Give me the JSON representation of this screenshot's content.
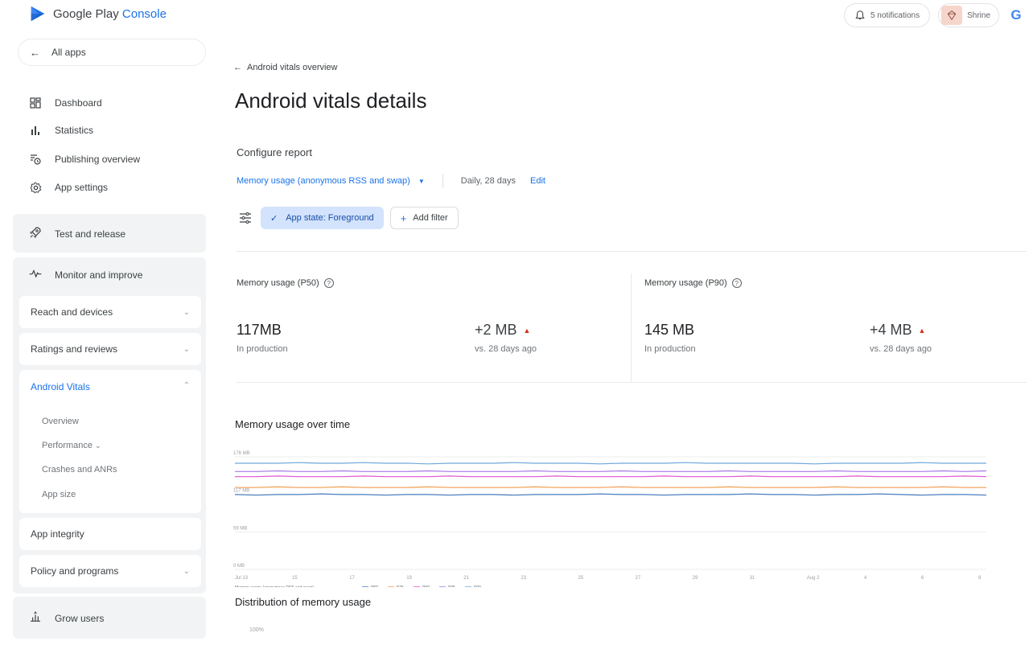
{
  "topbar": {
    "brand_prefix": "Google Play",
    "brand_suffix": "Console",
    "notifications_label": "5 notifications",
    "profile_label": "Shrine",
    "g_letter": "G"
  },
  "sidebar": {
    "all_apps": "All apps",
    "nav": [
      {
        "label": "Dashboard",
        "icon": "dashboard-icon"
      },
      {
        "label": "Statistics",
        "icon": "bar-chart-icon"
      },
      {
        "label": "Publishing overview",
        "icon": "publish-clock-icon"
      },
      {
        "label": "App settings",
        "icon": "gear-icon"
      }
    ],
    "test_release": "Test and release",
    "monitor_improve": "Monitor and improve",
    "reach_devices": "Reach and devices",
    "ratings_reviews": "Ratings and reviews",
    "android_vitals": "Android Vitals",
    "vitals_sub": [
      "Overview",
      "Performance",
      "Crashes and ANRs",
      "App size"
    ],
    "app_integrity": "App integrity",
    "policy_programs": "Policy and programs",
    "grow_users": "Grow users"
  },
  "main": {
    "back_link": "Android vitals overview",
    "title": "Android vitals details",
    "configure_label": "Configure report",
    "metric_selected": "Memory usage (anonymous RSS and swap)",
    "range": "Daily, 28 days",
    "edit": "Edit",
    "filter_active": "App state: Foreground",
    "add_filter": "Add filter",
    "cards": [
      {
        "title": "Memory usage (P50)",
        "value": "117MB",
        "sub": "In production",
        "delta": "+2 MB",
        "delta_sub": "vs. 28 days ago"
      },
      {
        "title": "Memory usage (P90)",
        "value": "145 MB",
        "sub": "In production",
        "delta": "+4 MB",
        "delta_sub": "vs. 28 days ago"
      }
    ],
    "chart_title": "Memory usage over time",
    "dist_title": "Distribution of memory usage",
    "dist_axis_top": "100%"
  },
  "colors": {
    "accent": "#1a73e8",
    "p50": "#4a7fc1",
    "p75": "#f29d52",
    "p90": "#e353d2",
    "p95": "#a678e8",
    "p99": "#6fa8dc"
  },
  "chart_data": {
    "type": "line",
    "title": "Memory usage over time",
    "y_ticks": [
      "176 MB",
      "117 MB",
      "59 MB",
      "0 MB"
    ],
    "ylim": [
      0,
      176
    ],
    "x_ticks": [
      "Jul 13",
      "15",
      "17",
      "19",
      "21",
      "23",
      "25",
      "27",
      "29",
      "31",
      "Aug 2",
      "4",
      "6",
      "8"
    ],
    "legend_label": "Memory usage (anonymous RSS and swap)",
    "series": [
      {
        "name": "P50",
        "values": [
          117,
          116,
          117,
          117,
          118,
          117,
          117,
          116,
          117,
          117,
          116,
          117,
          117,
          116,
          117,
          117,
          117,
          118,
          117,
          117,
          116,
          117,
          117,
          117,
          118,
          117,
          117,
          116,
          117,
          117,
          118,
          117,
          116,
          117,
          117,
          116
        ]
      },
      {
        "name": "P75",
        "values": [
          128,
          128,
          129,
          128,
          128,
          129,
          128,
          128,
          128,
          129,
          128,
          128,
          128,
          128,
          129,
          128,
          128,
          128,
          129,
          128,
          128,
          128,
          128,
          129,
          128,
          128,
          128,
          128,
          129,
          128,
          128,
          128,
          128,
          129,
          128,
          128
        ]
      },
      {
        "name": "P90",
        "values": [
          145,
          145,
          146,
          145,
          145,
          145,
          146,
          145,
          145,
          145,
          146,
          145,
          145,
          145,
          145,
          146,
          145,
          145,
          145,
          145,
          146,
          145,
          145,
          145,
          146,
          145,
          145,
          145,
          145,
          146,
          145,
          145,
          145,
          145,
          146,
          145
        ]
      },
      {
        "name": "P95",
        "values": [
          153,
          153,
          154,
          153,
          153,
          154,
          153,
          153,
          153,
          154,
          153,
          153,
          153,
          153,
          154,
          153,
          153,
          153,
          154,
          153,
          153,
          153,
          153,
          154,
          153,
          153,
          153,
          153,
          154,
          153,
          153,
          153,
          153,
          154,
          153,
          154
        ]
      },
      {
        "name": "P99",
        "values": [
          166,
          166,
          166,
          167,
          166,
          166,
          167,
          166,
          166,
          165,
          166,
          166,
          166,
          167,
          166,
          166,
          166,
          165,
          166,
          166,
          166,
          167,
          166,
          166,
          166,
          166,
          166,
          165,
          166,
          166,
          166,
          166,
          167,
          166,
          166,
          166
        ]
      }
    ]
  }
}
